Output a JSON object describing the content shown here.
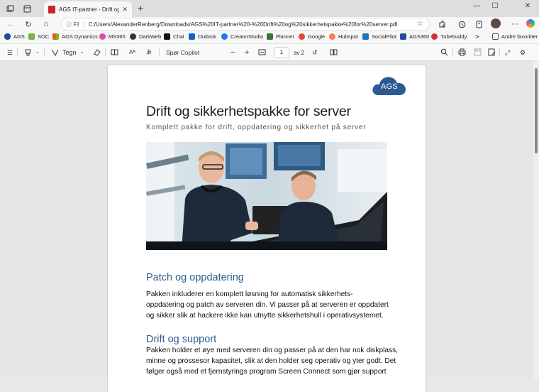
{
  "browser": {
    "tab_title": "AGS IT-partner - Drift og sikkerh",
    "tab_close": "✕",
    "new_tab": "+",
    "omnibox_info": "Fil",
    "url": "C:/Users/AlexanderRenberg/Downloads/AGS%20IT-partner%20-%20Drift%20og%20sikkerhetspakke%20for%20server.pdf",
    "window_controls": [
      "—",
      "☐",
      "✕"
    ],
    "nav": {
      "back": "←",
      "refresh": "↻",
      "home": "⌂",
      "more": "···"
    }
  },
  "favorites": [
    {
      "label": "AGS",
      "color": "#1f4e9b"
    },
    {
      "label": "SOC",
      "color": "#7cb342"
    },
    {
      "label": "AGS Dynamics",
      "color": "#f25022"
    },
    {
      "label": "MS365",
      "color": "#e04ba5"
    },
    {
      "label": "DarkWeb",
      "color": "#333333"
    },
    {
      "label": "Chat",
      "color": "#111111"
    },
    {
      "label": "Outlook",
      "color": "#0a64c9"
    },
    {
      "label": "CreatorStudio",
      "color": "#1877f2"
    },
    {
      "label": "Planner",
      "color": "#31752f"
    },
    {
      "label": "Google",
      "color": "#ea4335"
    },
    {
      "label": "Hubspot",
      "color": "#ff7a59"
    },
    {
      "label": "SocialPilot",
      "color": "#1e73be"
    },
    {
      "label": "AGS360",
      "color": "#1f4e9b"
    },
    {
      "label": "Tubebuddy",
      "color": "#d32f2f"
    }
  ],
  "favorites_overflow": ">",
  "favorites_other": "Andre favoritter",
  "pdf_toolbar": {
    "draw_label": "Tegn",
    "ask_copilot": "Spør Copilot",
    "zoom_out": "−",
    "zoom_in": "+",
    "page_number": "1",
    "page_total": "av 2"
  },
  "document": {
    "logo_text": "AGS",
    "title": "Drift og sikkerhetspakke for server",
    "subtitle": "Komplett pakke for drift, oppdatering og sikkerhet på server",
    "sections": [
      {
        "heading": "Patch og oppdatering",
        "lines": [
          "Pakken inkluderer en komplett løsning for automatisk sikkerhets-",
          "oppdatering og patch av serveren din. Vi passer på at serveren er oppdatert",
          "og sikker slik at hackere ikke kan utnytte sikkerhetshull i operativsystemet."
        ]
      },
      {
        "heading": "Drift og support",
        "lines": [
          "Pakken holder et øye med serveren din og passer på at den har nok diskplass,",
          "minne og prossesor kapasitet, slik at den holder seg operativ og yter godt. Det",
          "følger også med et fjernstyrings program Screen Connect som gjør support"
        ]
      }
    ]
  },
  "colors": {
    "heading_blue": "#2e5d8f",
    "logo_blue": "#2b5a94"
  }
}
